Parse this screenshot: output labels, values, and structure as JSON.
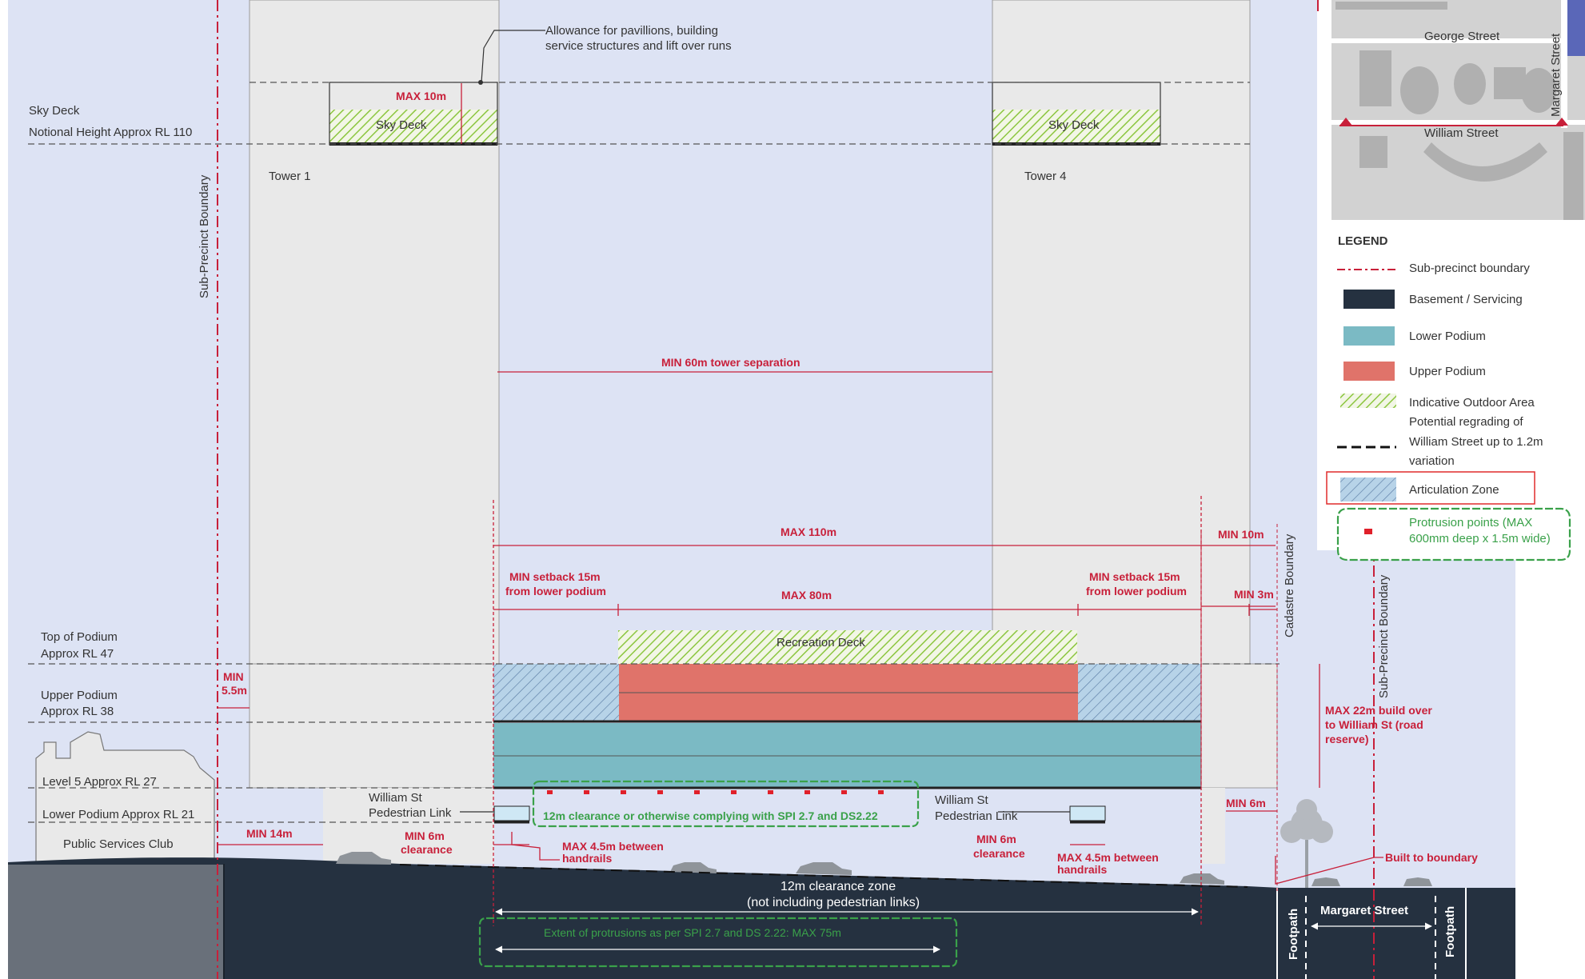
{
  "colors": {
    "sky": "#dde3f4",
    "tower": "#e9e9e9",
    "ground": "#253140",
    "upper_podium": "#e0736a",
    "lower_podium": "#7bbac4",
    "outdoor_hatch": "#8cc63f",
    "dimension_red": "#c8203a",
    "protrusion_green": "#3aa14a"
  },
  "labels": {
    "allowance": [
      "Allowance for pavillions, building",
      "service structures and lift over runs"
    ],
    "sky_deck_level": [
      "Sky Deck",
      "Notional Height Approx RL 110"
    ],
    "sky_deck_1": "Sky Deck",
    "sky_deck_4": "Sky Deck",
    "max_10m": "MAX 10m",
    "tower_1": "Tower 1",
    "tower_4": "Tower 4",
    "sub_precinct_boundary_left": "Sub-Precinct Boundary",
    "sub_precinct_boundary_right": "Sub-Precinct Boundary",
    "cadastre_boundary": "Cadastre Boundary",
    "min_60m": "MIN 60m tower separation",
    "max_110m": "MAX 110m",
    "min_10m": "MIN 10m",
    "setback_left": [
      "MIN setback 15m",
      "from lower podium"
    ],
    "setback_right": [
      "MIN setback 15m",
      "from lower podium"
    ],
    "max_80m": "MAX 80m",
    "min_3m": "MIN 3m",
    "recreation_deck": "Recreation Deck",
    "top_of_podium": [
      "Top of Podium",
      "Approx RL 47"
    ],
    "upper_podium_level": [
      "Upper Podium",
      "Approx RL 38"
    ],
    "min_5_5m": [
      "MIN",
      "5.5m"
    ],
    "level_5": "Level 5 Approx RL 27",
    "lower_podium_level": "Lower Podium Approx RL 21",
    "public_services_club": "Public Services Club",
    "min_14m": "MIN 14m",
    "william_link_left": [
      "William St",
      "Pedestrian Link"
    ],
    "william_link_right": [
      "William St",
      "Pedestrian Link"
    ],
    "min_6m_left": [
      "MIN 6m",
      "clearance"
    ],
    "min_6m_right": [
      "MIN 6m",
      "clearance"
    ],
    "handrails_left": [
      "MAX 4.5m between",
      "handrails"
    ],
    "handrails_right": [
      "MAX 4.5m between",
      "handrails"
    ],
    "clearance_12m": "12m clearance or otherwise complying with SPI 2.7 and DS2.22",
    "max_22m": [
      "MAX 22m build over",
      "to William St (road",
      "reserve)"
    ],
    "min_6m": "MIN 6m",
    "built_to_boundary": "Built to boundary",
    "clearance_zone": [
      "12m clearance zone",
      "(not including pedestrian links)"
    ],
    "extent_protrusions": "Extent of protrusions as per SPI 2.7 and DS 2.22: MAX 75m",
    "footpath_left": "Footpath",
    "footpath_right": "Footpath",
    "margaret_street_bottom": "Margaret Street"
  },
  "key_map": {
    "george_street": "George Street",
    "william_street": "William Street",
    "margaret_street": "Margaret Street"
  },
  "legend": {
    "title": "LEGEND",
    "items": [
      {
        "label": [
          "Sub-precinct boundary"
        ],
        "icon": "dash-dot-red-line"
      },
      {
        "label": [
          "Basement / Servicing"
        ],
        "icon": "dark-navy-swatch"
      },
      {
        "label": [
          "Lower Podium"
        ],
        "icon": "teal-swatch"
      },
      {
        "label": [
          "Upper Podium"
        ],
        "icon": "salmon-swatch"
      },
      {
        "label": [
          "Indicative Outdoor Area"
        ],
        "icon": "green-hatch"
      },
      {
        "label": [
          "Potential regrading of",
          "William Street up to 1.2m",
          "variation"
        ],
        "icon": "black-dashed-line"
      },
      {
        "label": [
          "Articulation Zone"
        ],
        "icon": "blue-hatch-swatch"
      },
      {
        "label": [
          "Protrusion points (MAX",
          "600mm deep x 1.5m wide)"
        ],
        "icon": "red-dot"
      }
    ]
  }
}
